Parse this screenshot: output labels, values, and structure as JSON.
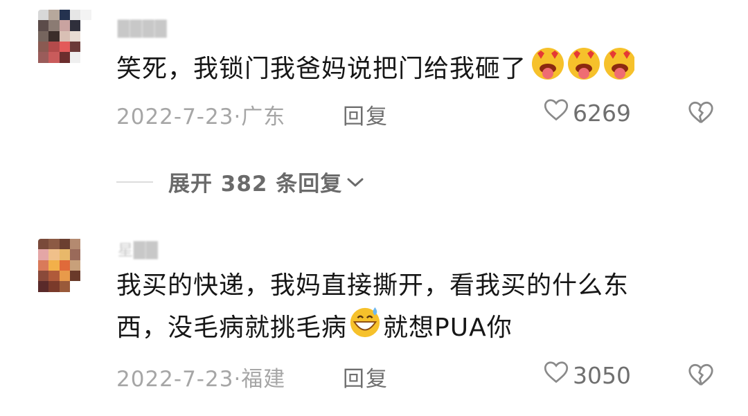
{
  "comments": [
    {
      "username": "████",
      "text_main": "笑死，我锁门我爸妈说把门给我砸了",
      "emoji": "star-struck-tongue-emoji",
      "date": "2022-7-23",
      "location": "广东",
      "reply_label": "回复",
      "likes": "6269",
      "avatar_colors": [
        "#d8d8d8",
        "#b7a89c",
        "#24324f",
        "#e6e6e6",
        "#f3f3f3",
        "#ffffff",
        "#5c4c4a",
        "#8b7b73",
        "#c9a3a0",
        "#2f2f3b",
        "#ffffff",
        "#ffffff",
        "#76655e",
        "#3b2d2a",
        "#d9c0b5",
        "#e8dcd3",
        "#ffffff",
        "#ffffff",
        "#8a5a52",
        "#b34b4b",
        "#e35a5a",
        "#6b3a38",
        "#ffffff",
        "#ffffff",
        "#9a5c5a",
        "#c95b5b",
        "#6c2e2e",
        "#efefef",
        "#ffffff",
        "#ffffff",
        "#ffffff",
        "#ffffff",
        "#ffffff",
        "#ffffff",
        "#ffffff",
        "#ffffff"
      ]
    },
    {
      "username": "星██",
      "text_line1": "我买的快递，我妈直接撕开，看我买的什么东",
      "text_line2_before": "西，没毛病就挑毛病",
      "emoji": "grinning-sweat-emoji",
      "text_line2_after": "就想PUA你",
      "date": "2022-7-23",
      "location": "福建",
      "reply_label": "回复",
      "likes": "3050",
      "avatar_colors": [
        "#7a4a3a",
        "#8c5a44",
        "#6b3f30",
        "#b48a70",
        "#ffffff",
        "#ffffff",
        "#e4a6a6",
        "#f0c08a",
        "#e8b86a",
        "#9a6a5a",
        "#ffffff",
        "#ffffff",
        "#d97a5a",
        "#f2b04a",
        "#e06a3a",
        "#c8a07a",
        "#ffffff",
        "#ffffff",
        "#8a4a3a",
        "#b05a3a",
        "#e89a4a",
        "#6a3a2a",
        "#ffffff",
        "#ffffff",
        "#5a2a2a",
        "#7a3a2a",
        "#9a5a3a",
        "#ffffff",
        "#ffffff",
        "#ffffff",
        "#ffffff",
        "#ffffff",
        "#ffffff",
        "#ffffff",
        "#ffffff",
        "#ffffff"
      ]
    }
  ],
  "expand_replies": {
    "label": "展开 382 条回复"
  },
  "colors": {
    "meta_gray": "#a6a6a6",
    "action_gray": "#6f6f6f",
    "text_dark": "#161616"
  }
}
